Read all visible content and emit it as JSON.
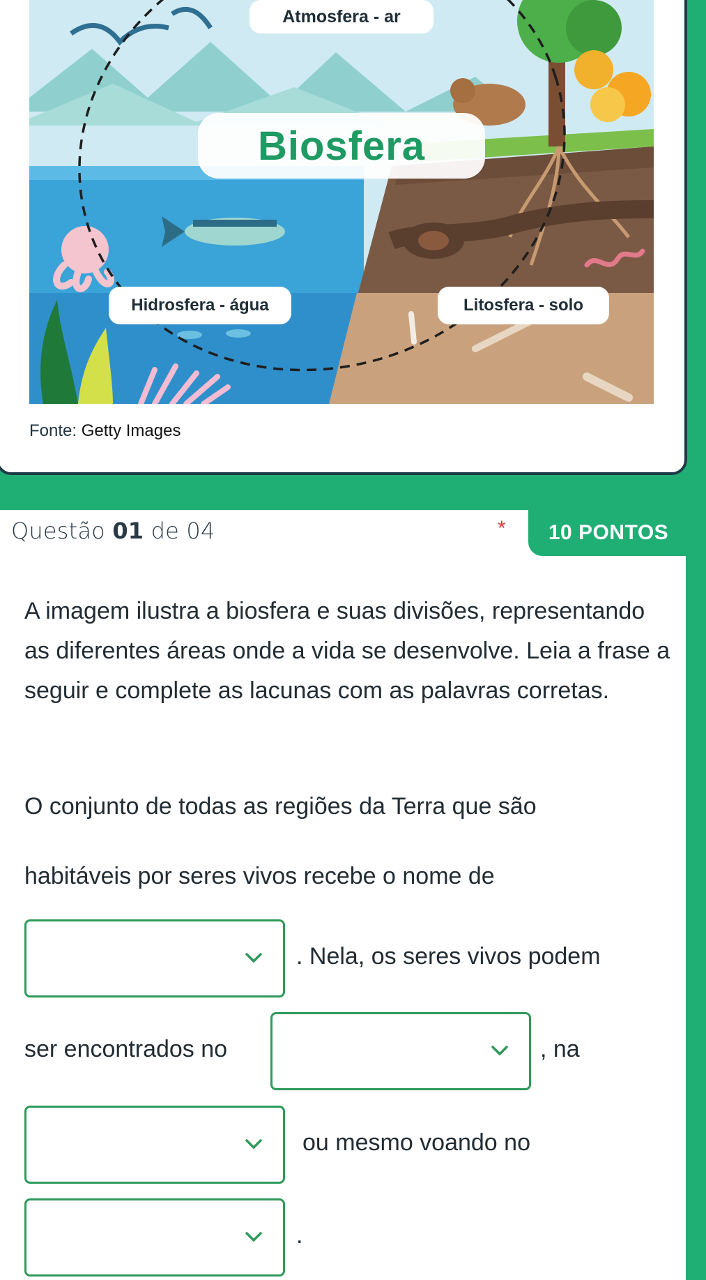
{
  "figure": {
    "labels": {
      "atmosfera": "Atmosfera - ar",
      "biosfera": "Biosfera",
      "hidrosfera": "Hidrosfera - água",
      "litosfera": "Litosfera - solo"
    },
    "source_prefix": "Fonte:",
    "source_name": "Getty Images"
  },
  "question": {
    "label": "Questão",
    "number": "01",
    "of_label": "de 04",
    "required_mark": "*",
    "points": "10 PONTOS",
    "statement": "A imagem ilustra a biosfera e suas divisões, representando as diferentes áreas onde a vida se desenvolve. Leia a frase a seguir e complete as lacunas com as palavras corretas.",
    "sentence": {
      "part1": "O conjunto de todas as regiões da Terra que são",
      "part2": "habitáveis por seres vivos recebe o nome de",
      "part3": ". Nela, os seres vivos podem",
      "part4": "ser encontrados no",
      "part5": ", na",
      "part6": "ou mesmo voando no",
      "part7": "."
    },
    "dropdowns": [
      {
        "selected": ""
      },
      {
        "selected": ""
      },
      {
        "selected": ""
      },
      {
        "selected": ""
      }
    ]
  },
  "colors": {
    "accent": "#1fae74",
    "border_dark": "#1d3a48",
    "dropdown_border": "#2e9a5a",
    "required": "#d93c3c"
  }
}
